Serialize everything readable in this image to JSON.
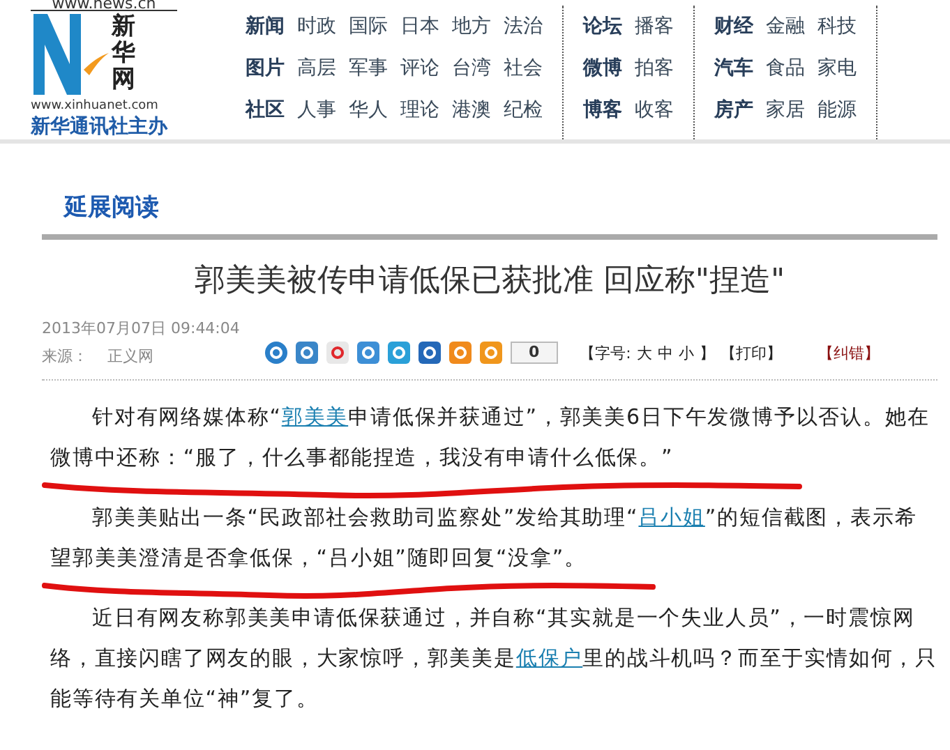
{
  "logo": {
    "url_top": "www.news.cn",
    "site": "www.xinhuanet.com",
    "tagline": "新华通讯社主办",
    "name": "新华网"
  },
  "nav": [
    {
      "rows": [
        {
          "heading": "新闻",
          "links": [
            "时政",
            "国际",
            "日本",
            "地方",
            "法治"
          ]
        },
        {
          "heading": "图片",
          "links": [
            "高层",
            "军事",
            "评论",
            "台湾",
            "社会"
          ]
        },
        {
          "heading": "社区",
          "links": [
            "人事",
            "华人",
            "理论",
            "港澳",
            "纪检"
          ]
        }
      ]
    },
    {
      "rows": [
        {
          "heading": "论坛",
          "links": [
            "播客"
          ]
        },
        {
          "heading": "微博",
          "links": [
            "拍客"
          ]
        },
        {
          "heading": "博客",
          "links": [
            "收客"
          ]
        }
      ]
    },
    {
      "rows": [
        {
          "heading": "财经",
          "links": [
            "金融",
            "科技"
          ]
        },
        {
          "heading": "汽车",
          "links": [
            "食品",
            "家电"
          ]
        },
        {
          "heading": "房产",
          "links": [
            "家居",
            "能源"
          ]
        }
      ]
    }
  ],
  "section_title": "延展阅读",
  "article": {
    "title": "郭美美被传申请低保已获批准  回应称\"捏造\"",
    "date": "2013年07月07日  09:44:04",
    "source_label": "来源：",
    "source": "正义网",
    "share_icons": [
      {
        "color": "#2a7fc9"
      },
      {
        "color": "#3a86c8"
      },
      {
        "color": "#e8e8e8"
      },
      {
        "color": "#3d8fd6"
      },
      {
        "color": "#2aa0d8"
      },
      {
        "color": "#2468b8"
      },
      {
        "color": "#f08a1c"
      },
      {
        "color": "#f0961c"
      }
    ],
    "share_count": "0",
    "font_label": "【字号:",
    "font_sizes": [
      "大",
      "中",
      "小"
    ],
    "font_end": "】",
    "print": "【打印】",
    "report": "【纠错】",
    "paragraphs": [
      {
        "underlined": true,
        "segments": [
          {
            "text": "针对有网络媒体称“",
            "kind": "text"
          },
          {
            "text": "郭美美",
            "kind": "link"
          },
          {
            "text": "申请低保并获通过”，郭美美6日下午发微博予以否认。她在微博中还称：“服了，什么事都能捏造，我没有申请什么低保。”",
            "kind": "text"
          }
        ]
      },
      {
        "underlined": true,
        "segments": [
          {
            "text": "郭美美贴出一条“民政部社会救助司监察处”发给其助理“",
            "kind": "text"
          },
          {
            "text": "吕小姐",
            "kind": "link"
          },
          {
            "text": "”的短信截图，表示希望郭美美澄清是否拿低保，“吕小姐”随即回复“没拿”。",
            "kind": "text"
          }
        ]
      },
      {
        "underlined": false,
        "segments": [
          {
            "text": "近日有网友称郭美美申请低保获通过，并自称“其实就是一个失业人员”，一时震惊网络，直接闪瞎了网友的眼，大家惊呼，郭美美是",
            "kind": "text"
          },
          {
            "text": "低保户",
            "kind": "link"
          },
          {
            "text": "里的战斗机吗？而至于实情如何，只能等待有关单位“神”复了。",
            "kind": "text"
          }
        ]
      }
    ]
  }
}
